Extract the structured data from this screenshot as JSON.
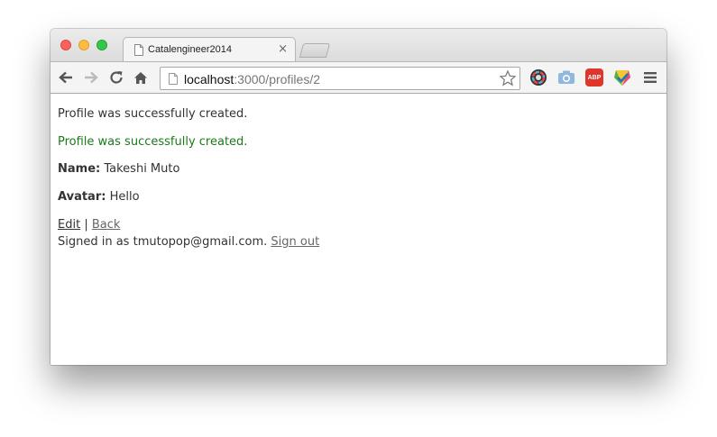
{
  "browser": {
    "tab_title": "Catalengineer2014",
    "tab_close_glyph": "×",
    "url_host": "localhost",
    "url_path": ":3000/profiles/2",
    "extensions": [
      "color-picker-icon",
      "camera-icon",
      "adblock-plus-icon",
      "check-shield-icon"
    ],
    "abp_label": "ABP"
  },
  "page": {
    "notice_plain": "Profile was successfully created.",
    "notice_green": "Profile was successfully created.",
    "name_label": "Name:",
    "name_value": "Takeshi Muto",
    "avatar_label": "Avatar:",
    "avatar_value": "Hello",
    "edit_link": "Edit",
    "separator": "|",
    "back_link": "Back",
    "signed_in_text": "Signed in as tmutopop@gmail.com.",
    "sign_out_link": "Sign out"
  },
  "colors": {
    "notice_green": "#1a7a1a",
    "close_dot": "#fc605c",
    "min_dot": "#fdbc40",
    "max_dot": "#34c84a",
    "abp_red": "#e0352b"
  }
}
